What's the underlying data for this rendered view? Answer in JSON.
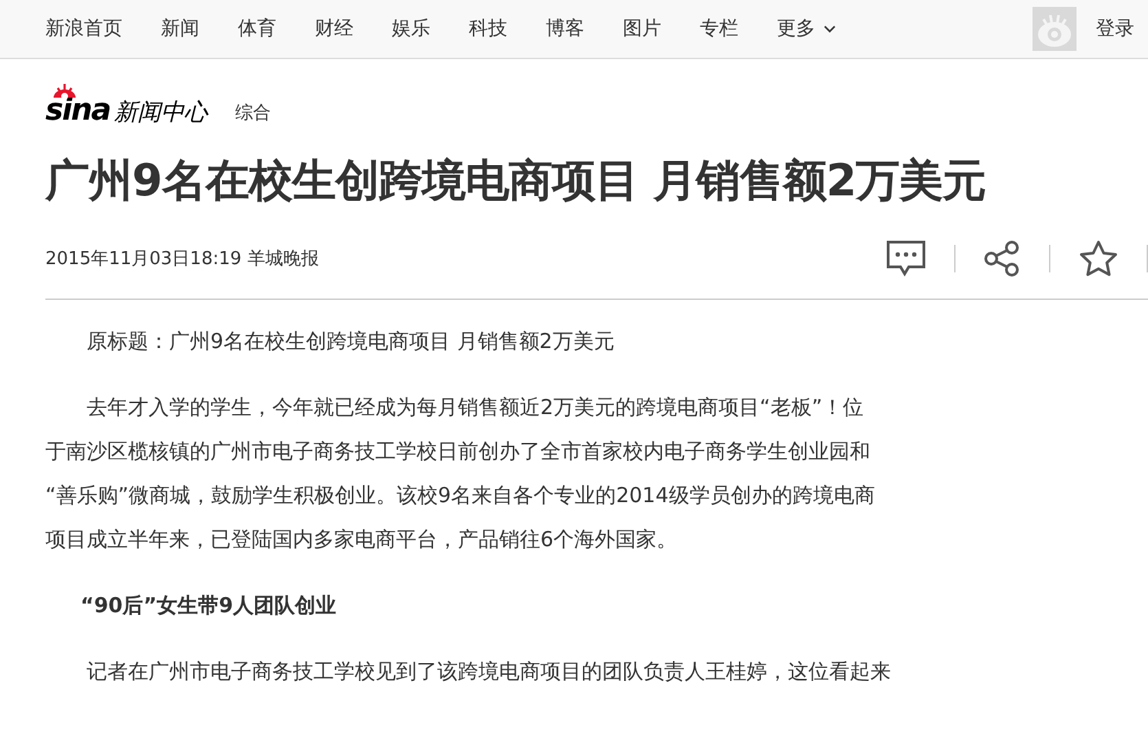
{
  "nav": {
    "items": [
      {
        "label": "新浪首页"
      },
      {
        "label": "新闻"
      },
      {
        "label": "体育"
      },
      {
        "label": "财经"
      },
      {
        "label": "娱乐"
      },
      {
        "label": "科技"
      },
      {
        "label": "博客"
      },
      {
        "label": "图片"
      },
      {
        "label": "专栏"
      },
      {
        "label": "更多",
        "dropdown": true
      }
    ],
    "login": "登录"
  },
  "header": {
    "logo": "sina",
    "section": "新闻中心",
    "channel": "综合"
  },
  "article": {
    "title": "广州9名在校生创跨境电商项目 月销售额2万美元",
    "meta": "2015年11月03日18:19 羊城晚报",
    "blocks": [
      {
        "kind": "para",
        "lines": [
          "原标题：广州9名在校生创跨境电商项目 月销售额2万美元"
        ]
      },
      {
        "kind": "para",
        "lines": [
          "去年才入学的学生，今年就已经成为每月销售额近2万美元的跨境电商项目“老板”！位",
          "于南沙区榄核镇的广州市电子商务技工学校日前创办了全市首家校内电子商务学生创业园和",
          "“善乐购”微商城，鼓励学生积极创业。该校9名来自各个专业的2014级学员创办的跨境电商",
          "项目成立半年来，已登陆国内多家电商平台，产品销往6个海外国家。"
        ]
      },
      {
        "kind": "heading",
        "lines": [
          "“90后”女生带9人团队创业"
        ]
      },
      {
        "kind": "para",
        "lines": [
          "记者在广州市电子商务技工学校见到了该跨境电商项目的团队负责人王桂婷，这位看起来"
        ]
      }
    ]
  }
}
